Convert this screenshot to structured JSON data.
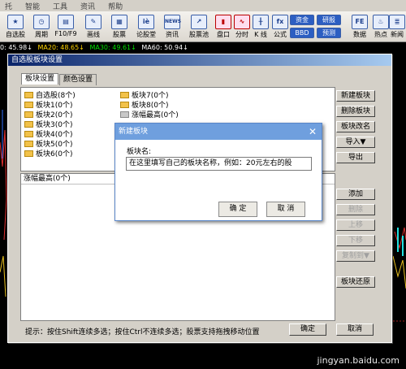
{
  "menu": [
    "托",
    "智能",
    "工具",
    "资讯",
    "帮助"
  ],
  "toolbar": {
    "tools": [
      "自选股",
      "周期",
      "F10/F9",
      "画线",
      "股票",
      "论股堂",
      "资讯",
      "股票池",
      "盘口",
      "分时",
      "K 线",
      "公式"
    ],
    "pills": [
      "资金",
      "研报",
      "BBD",
      "预测"
    ],
    "right_tools": [
      "数据",
      "热点",
      "新闻"
    ],
    "news_icon_text": "NEWS",
    "ie_icon_text": "iè"
  },
  "ma_line": [
    {
      "text": "0: 45.98↓",
      "color": "#ffffff"
    },
    {
      "text": "MA20: 48.65↓",
      "color": "#ffd400"
    },
    {
      "text": "MA30: 49.61↓",
      "color": "#00e000"
    },
    {
      "text": "MA60: 50.94↓",
      "color": "#ffffff"
    }
  ],
  "dialog": {
    "title": "自选股板块设置",
    "tabs": [
      "板块设置",
      "颜色设置"
    ],
    "blocks_col1": [
      "自选股(8个)",
      "板块1(0个)",
      "板块2(0个)",
      "板块3(0个)",
      "板块4(0个)",
      "板块5(0个)",
      "板块6(0个)"
    ],
    "blocks_col2": [
      "板块7(0个)",
      "板块8(0个)",
      "涨幅最高(0个)"
    ],
    "side_buttons": [
      "新建板块",
      "删除板块",
      "板块改名",
      "导入▼",
      "导出"
    ],
    "side_buttons2": [
      {
        "label": "添加",
        "enabled": true
      },
      {
        "label": "删除",
        "enabled": false
      },
      {
        "label": "上移",
        "enabled": false
      },
      {
        "label": "下移",
        "enabled": false
      },
      {
        "label": "复制到▼",
        "enabled": false
      }
    ],
    "restore_label": "板块还原",
    "list2_header": "涨幅最高(0个)",
    "tip": "提示：按住Shift连续多选；按住Ctrl不连续多选；股票支持拖拽移动位置",
    "ok_label": "确定",
    "cancel_label": "取消"
  },
  "popup": {
    "title": "新建板块",
    "label": "板块名:",
    "input_value": "在这里填写自己的板块名称，例如：20元左右的股",
    "ok_label": "确 定",
    "cancel_label": "取 消"
  },
  "watermark": "jingyan.baidu.com"
}
